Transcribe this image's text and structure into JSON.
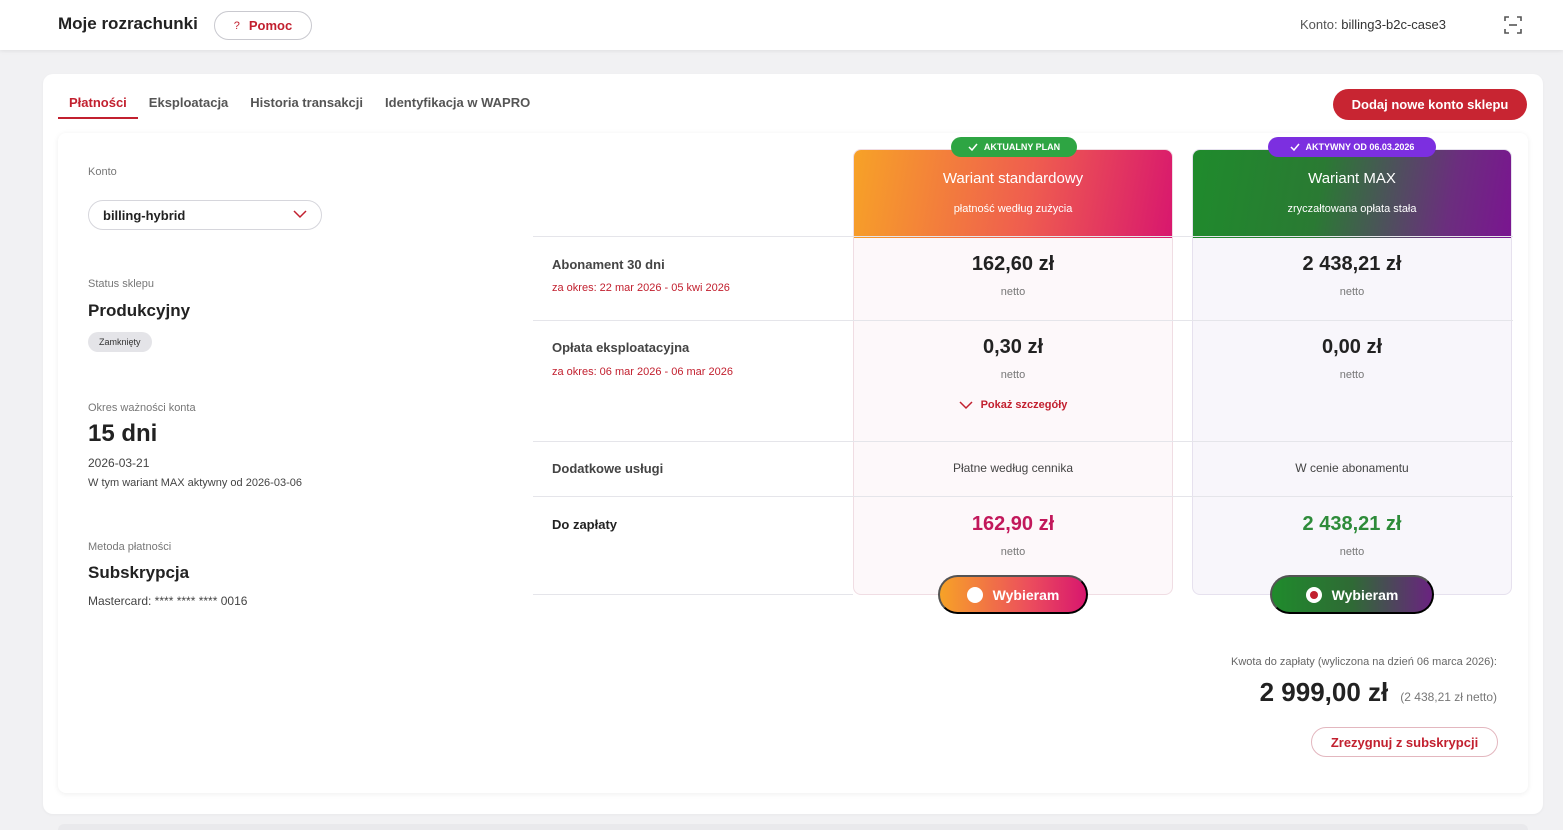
{
  "header": {
    "title": "Moje rozrachunki",
    "help_label": "Pomoc",
    "account_label": "Konto:",
    "account_value": "billing3-b2c-case3"
  },
  "tabs": [
    {
      "label": "Płatności",
      "active": true
    },
    {
      "label": "Eksploatacja",
      "active": false
    },
    {
      "label": "Historia transakcji",
      "active": false
    },
    {
      "label": "Identyfikacja w WAPRO",
      "active": false
    }
  ],
  "add_shop_button": "Dodaj nowe konto sklepu",
  "account_panel": {
    "account_label": "Konto",
    "account_selected": "billing-hybrid",
    "status_label": "Status sklepu",
    "status_value": "Produkcyjny",
    "status_badge": "Zamknięty",
    "validity_label": "Okres ważności konta",
    "validity_days": "15 dni",
    "validity_date": "2026-03-21",
    "validity_note": "W tym wariant MAX aktywny od 2026-03-06",
    "payment_label": "Metoda płatności",
    "payment_value": "Subskrypcja",
    "card_value": "Mastercard: **** **** **** 0016"
  },
  "rows": {
    "subscription": {
      "label": "Abonament 30 dni",
      "period": "za okres: 22 mar 2026 - 05 kwi 2026"
    },
    "operation": {
      "label": "Opłata eksploatacyjna",
      "period": "za okres: 06 mar 2026 - 06 mar 2026"
    },
    "extra": {
      "label": "Dodatkowe usługi"
    },
    "total": {
      "label": "Do zapłaty"
    }
  },
  "plans": {
    "standard": {
      "badge": "AKTUALNY PLAN",
      "name": "Wariant standardowy",
      "subtitle": "płatność według zużycia",
      "subscription_price": "162,60 zł",
      "operation_price": "0,30 zł",
      "details_label": "Pokaż szczegóły",
      "extra_text": "Płatne według cennika",
      "total_price": "162,90 zł",
      "netto": "netto",
      "choose_label": "Wybieram",
      "total_color": "#c2185b"
    },
    "max": {
      "badge": "AKTYWNY OD 06.03.2026",
      "name": "Wariant MAX",
      "subtitle": "zryczałtowana opłata stała",
      "subscription_price": "2 438,21 zł",
      "operation_price": "0,00 zł",
      "extra_text": "W cenie abonamentu",
      "total_price": "2 438,21 zł",
      "netto": "netto",
      "choose_label": "Wybieram",
      "total_color": "#2e8b3a"
    }
  },
  "summary": {
    "label": "Kwota do zapłaty (wyliczona na dzień 06 marca 2026):",
    "amount": "2 999,00 zł",
    "netto": "(2 438,21 zł netto)",
    "cancel_label": "Zrezygnuj z subskrypcji"
  },
  "colors": {
    "accent": "#c82532",
    "green": "#2ea543",
    "purple": "#7c2fe0"
  }
}
